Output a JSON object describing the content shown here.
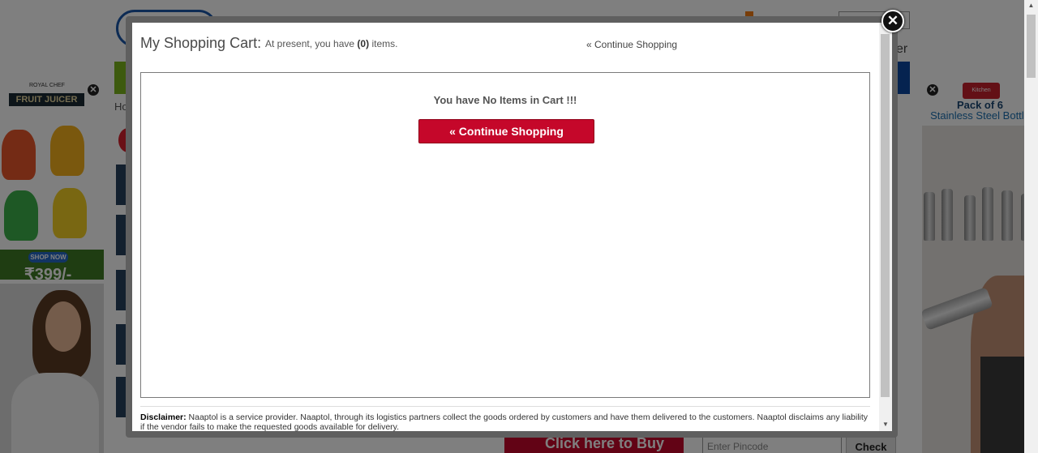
{
  "background": {
    "breadcrumb_fragment": "Ho",
    "search_fragment": "er",
    "buy_button": "Click here to Buy",
    "pincode_placeholder": "Enter Pincode",
    "check_button": "Check"
  },
  "ads": {
    "left": {
      "brand": "ROYAL CHEF",
      "product": "FRUIT JUICER",
      "shop_button": "SHOP NOW",
      "price": "₹399/-"
    },
    "right": {
      "brand": "Kitchen Queen",
      "headline": "Pack of 6",
      "subheadline": "Stainless Steel Bottle"
    }
  },
  "modal": {
    "title": "My Shopping Cart:",
    "subtitle_prefix": "At present, you have",
    "item_count": "(0)",
    "subtitle_suffix": "items.",
    "header_continue": "« Continue Shopping",
    "empty_message": "You have No Items in Cart !!!",
    "continue_button": "« Continue Shopping",
    "disclaimer_label": "Disclaimer:",
    "disclaimer_text": "Naaptol is a service provider. Naaptol, through its logistics partners collect the goods ordered by customers and have them delivered to the customers. Naaptol disclaims any liability if the vendor fails to make the requested goods available for delivery.",
    "close_symbol": "✕"
  },
  "icons": {
    "modal_close": "close-icon",
    "ad_close": "close-icon",
    "scroll_down": "chevron-down-icon",
    "scroll_up": "chevron-up-icon"
  },
  "colors": {
    "primary_button": "#c5072a",
    "overlay": "rgba(0,0,0,0.5)",
    "nav_green": "#7ab51d",
    "nav_blue": "#0b47a1"
  }
}
